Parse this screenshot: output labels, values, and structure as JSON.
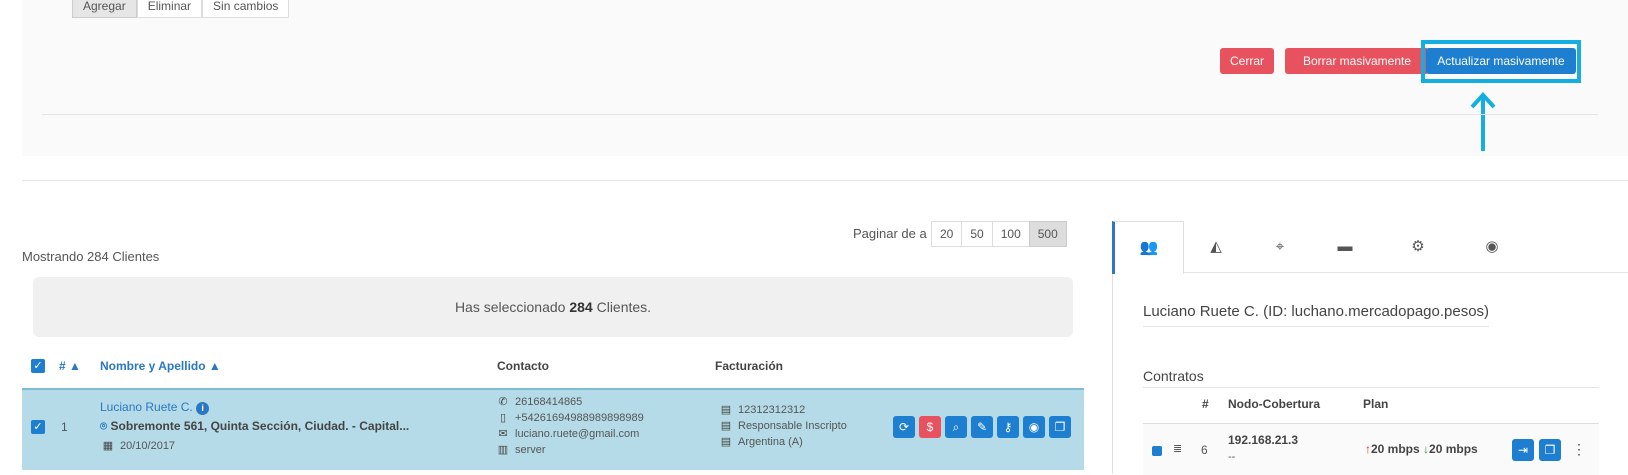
{
  "top_buttons": [
    "Agregar",
    "Eliminar",
    "Sin cambios"
  ],
  "actions": {
    "close": "Cerrar",
    "bulk_delete": "Borrar masivamente",
    "bulk_update": "Actualizar masivamente"
  },
  "listing": {
    "showing": "Mostrando 284 Clientes",
    "paginate_label": "Paginar de a",
    "page_sizes": [
      "20",
      "50",
      "100",
      "500"
    ],
    "active_page_size": "500"
  },
  "selection": {
    "prefix": "Has seleccionado ",
    "count": "284",
    "suffix": " Clientes."
  },
  "table": {
    "headers": {
      "num": "# ▲",
      "name": "Nombre y Apellido ▲",
      "contact": "Contacto",
      "billing": "Facturación"
    },
    "rows": [
      {
        "index": "1",
        "name": "Luciano Ruete C.",
        "address": "Sobremonte 561, Quinta Sección, Ciudad. - Capital...",
        "date": "20/10/2017",
        "phone": "26168414865",
        "mobile": "+54261694988989898989",
        "email": "luciano.ruete@gmail.com",
        "server": "server",
        "tax_id": "12312312312",
        "tax_condition": "Responsable Inscripto",
        "country": "Argentina (A)"
      }
    ]
  },
  "detail": {
    "title": "Luciano Ruete C. (ID: luchano.mercadopago.pesos)",
    "contracts_label": "Contratos",
    "contract_headers": {
      "num": "#",
      "node": "Nodo-Cobertura",
      "plan": "Plan"
    },
    "contract": {
      "num": "6",
      "ip": "192.168.21.3",
      "ip_sub": "--",
      "up": "20 mbps",
      "down": "20 mbps"
    }
  },
  "icons": [
    "check-icon",
    "info-icon",
    "map-pin-icon",
    "calendar-icon",
    "phone-icon",
    "mobile-icon",
    "envelope-icon",
    "map-icon",
    "id-card-icon",
    "document-icon",
    "refresh-icon",
    "dollar-icon",
    "search-icon",
    "pencil-icon",
    "key-icon",
    "eye-icon",
    "copy-icon",
    "users-cog-icon",
    "area-chart-icon",
    "location-icon",
    "credit-card-icon",
    "android-apple-icon",
    "signal-icon",
    "arrow-up-icon",
    "arrow-down-icon",
    "sign-out-icon",
    "kebab-icon"
  ],
  "colors": {
    "accent": "#1e7ed0",
    "danger": "#e8525f",
    "highlight": "#14aee0",
    "row_selected": "#b5dbe8"
  }
}
